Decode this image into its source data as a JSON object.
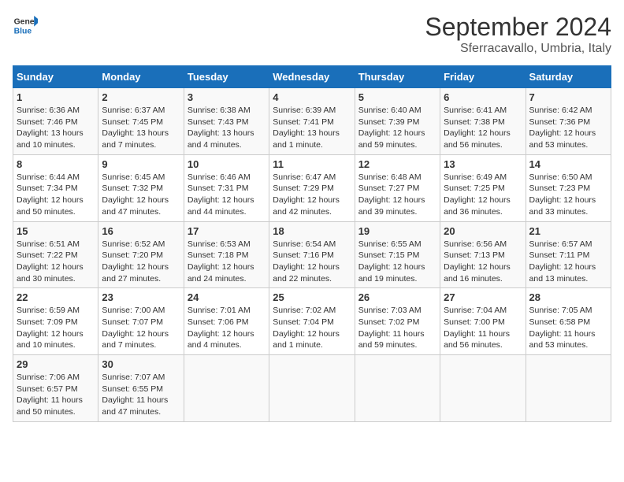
{
  "header": {
    "logo_text_general": "General",
    "logo_text_blue": "Blue",
    "month": "September 2024",
    "location": "Sferracavallo, Umbria, Italy"
  },
  "weekdays": [
    "Sunday",
    "Monday",
    "Tuesday",
    "Wednesday",
    "Thursday",
    "Friday",
    "Saturday"
  ],
  "weeks": [
    [
      {
        "day": "1",
        "sunrise": "Sunrise: 6:36 AM",
        "sunset": "Sunset: 7:46 PM",
        "daylight": "Daylight: 13 hours and 10 minutes."
      },
      {
        "day": "2",
        "sunrise": "Sunrise: 6:37 AM",
        "sunset": "Sunset: 7:45 PM",
        "daylight": "Daylight: 13 hours and 7 minutes."
      },
      {
        "day": "3",
        "sunrise": "Sunrise: 6:38 AM",
        "sunset": "Sunset: 7:43 PM",
        "daylight": "Daylight: 13 hours and 4 minutes."
      },
      {
        "day": "4",
        "sunrise": "Sunrise: 6:39 AM",
        "sunset": "Sunset: 7:41 PM",
        "daylight": "Daylight: 13 hours and 1 minute."
      },
      {
        "day": "5",
        "sunrise": "Sunrise: 6:40 AM",
        "sunset": "Sunset: 7:39 PM",
        "daylight": "Daylight: 12 hours and 59 minutes."
      },
      {
        "day": "6",
        "sunrise": "Sunrise: 6:41 AM",
        "sunset": "Sunset: 7:38 PM",
        "daylight": "Daylight: 12 hours and 56 minutes."
      },
      {
        "day": "7",
        "sunrise": "Sunrise: 6:42 AM",
        "sunset": "Sunset: 7:36 PM",
        "daylight": "Daylight: 12 hours and 53 minutes."
      }
    ],
    [
      {
        "day": "8",
        "sunrise": "Sunrise: 6:44 AM",
        "sunset": "Sunset: 7:34 PM",
        "daylight": "Daylight: 12 hours and 50 minutes."
      },
      {
        "day": "9",
        "sunrise": "Sunrise: 6:45 AM",
        "sunset": "Sunset: 7:32 PM",
        "daylight": "Daylight: 12 hours and 47 minutes."
      },
      {
        "day": "10",
        "sunrise": "Sunrise: 6:46 AM",
        "sunset": "Sunset: 7:31 PM",
        "daylight": "Daylight: 12 hours and 44 minutes."
      },
      {
        "day": "11",
        "sunrise": "Sunrise: 6:47 AM",
        "sunset": "Sunset: 7:29 PM",
        "daylight": "Daylight: 12 hours and 42 minutes."
      },
      {
        "day": "12",
        "sunrise": "Sunrise: 6:48 AM",
        "sunset": "Sunset: 7:27 PM",
        "daylight": "Daylight: 12 hours and 39 minutes."
      },
      {
        "day": "13",
        "sunrise": "Sunrise: 6:49 AM",
        "sunset": "Sunset: 7:25 PM",
        "daylight": "Daylight: 12 hours and 36 minutes."
      },
      {
        "day": "14",
        "sunrise": "Sunrise: 6:50 AM",
        "sunset": "Sunset: 7:23 PM",
        "daylight": "Daylight: 12 hours and 33 minutes."
      }
    ],
    [
      {
        "day": "15",
        "sunrise": "Sunrise: 6:51 AM",
        "sunset": "Sunset: 7:22 PM",
        "daylight": "Daylight: 12 hours and 30 minutes."
      },
      {
        "day": "16",
        "sunrise": "Sunrise: 6:52 AM",
        "sunset": "Sunset: 7:20 PM",
        "daylight": "Daylight: 12 hours and 27 minutes."
      },
      {
        "day": "17",
        "sunrise": "Sunrise: 6:53 AM",
        "sunset": "Sunset: 7:18 PM",
        "daylight": "Daylight: 12 hours and 24 minutes."
      },
      {
        "day": "18",
        "sunrise": "Sunrise: 6:54 AM",
        "sunset": "Sunset: 7:16 PM",
        "daylight": "Daylight: 12 hours and 22 minutes."
      },
      {
        "day": "19",
        "sunrise": "Sunrise: 6:55 AM",
        "sunset": "Sunset: 7:15 PM",
        "daylight": "Daylight: 12 hours and 19 minutes."
      },
      {
        "day": "20",
        "sunrise": "Sunrise: 6:56 AM",
        "sunset": "Sunset: 7:13 PM",
        "daylight": "Daylight: 12 hours and 16 minutes."
      },
      {
        "day": "21",
        "sunrise": "Sunrise: 6:57 AM",
        "sunset": "Sunset: 7:11 PM",
        "daylight": "Daylight: 12 hours and 13 minutes."
      }
    ],
    [
      {
        "day": "22",
        "sunrise": "Sunrise: 6:59 AM",
        "sunset": "Sunset: 7:09 PM",
        "daylight": "Daylight: 12 hours and 10 minutes."
      },
      {
        "day": "23",
        "sunrise": "Sunrise: 7:00 AM",
        "sunset": "Sunset: 7:07 PM",
        "daylight": "Daylight: 12 hours and 7 minutes."
      },
      {
        "day": "24",
        "sunrise": "Sunrise: 7:01 AM",
        "sunset": "Sunset: 7:06 PM",
        "daylight": "Daylight: 12 hours and 4 minutes."
      },
      {
        "day": "25",
        "sunrise": "Sunrise: 7:02 AM",
        "sunset": "Sunset: 7:04 PM",
        "daylight": "Daylight: 12 hours and 1 minute."
      },
      {
        "day": "26",
        "sunrise": "Sunrise: 7:03 AM",
        "sunset": "Sunset: 7:02 PM",
        "daylight": "Daylight: 11 hours and 59 minutes."
      },
      {
        "day": "27",
        "sunrise": "Sunrise: 7:04 AM",
        "sunset": "Sunset: 7:00 PM",
        "daylight": "Daylight: 11 hours and 56 minutes."
      },
      {
        "day": "28",
        "sunrise": "Sunrise: 7:05 AM",
        "sunset": "Sunset: 6:58 PM",
        "daylight": "Daylight: 11 hours and 53 minutes."
      }
    ],
    [
      {
        "day": "29",
        "sunrise": "Sunrise: 7:06 AM",
        "sunset": "Sunset: 6:57 PM",
        "daylight": "Daylight: 11 hours and 50 minutes."
      },
      {
        "day": "30",
        "sunrise": "Sunrise: 7:07 AM",
        "sunset": "Sunset: 6:55 PM",
        "daylight": "Daylight: 11 hours and 47 minutes."
      },
      null,
      null,
      null,
      null,
      null
    ]
  ]
}
